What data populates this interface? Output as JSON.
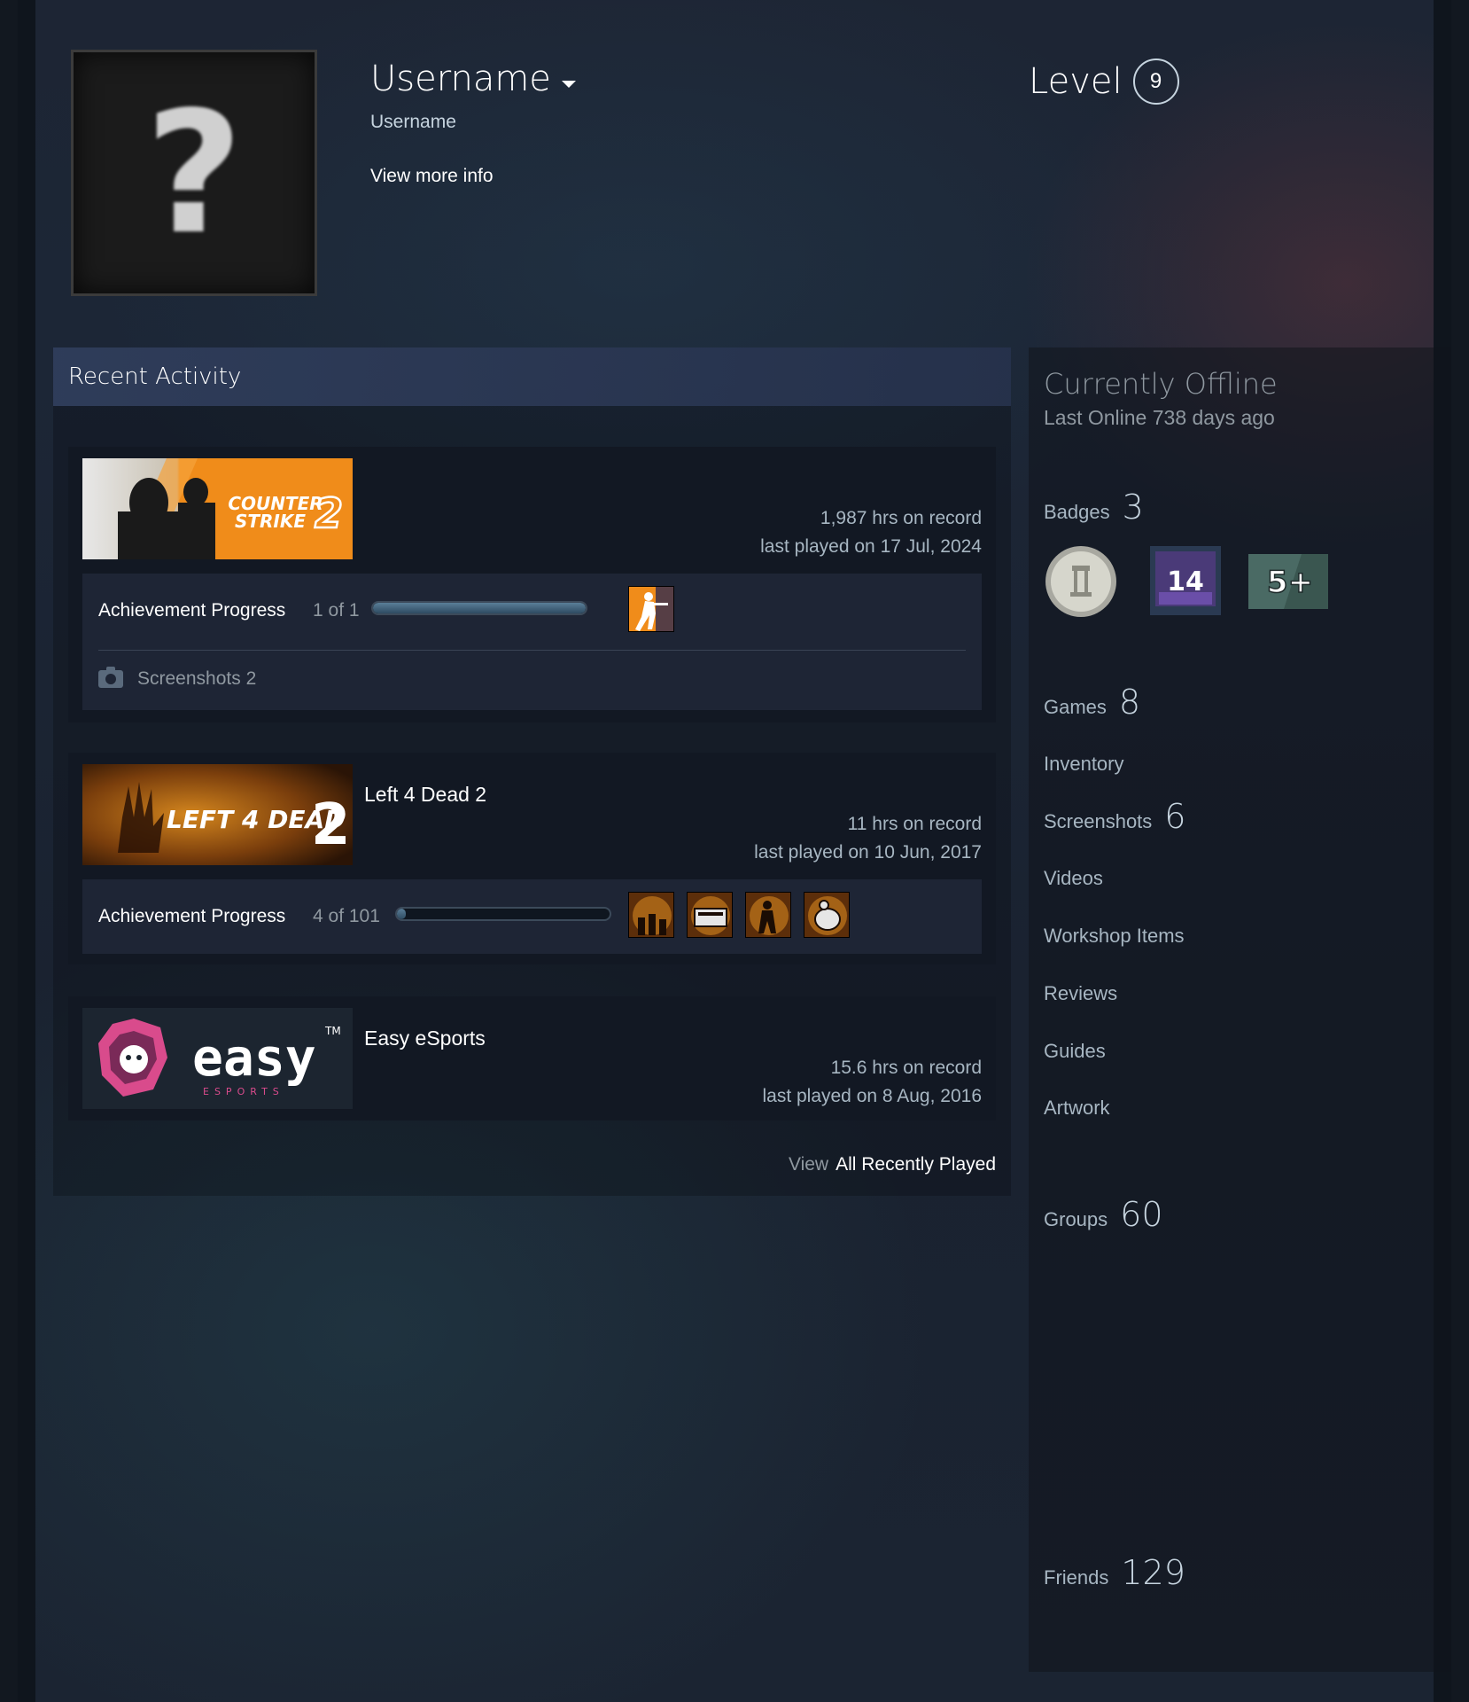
{
  "profile": {
    "persona_name": "Username",
    "real_name": "Username",
    "view_more": "View more info",
    "level_label": "Level",
    "level": "9"
  },
  "recent_activity": {
    "title": "Recent Activity",
    "games": [
      {
        "name": "",
        "logo_text": [
          "COUNTER",
          "STRIKE"
        ],
        "logo_number": "2",
        "hours": "1,987 hrs on record",
        "last_played": "last played on 17 Jul, 2024",
        "achievement_label": "Achievement Progress",
        "achievement_count": "1 of 1",
        "achievement_progress": 1.0,
        "screenshots_label": "Screenshots 2"
      },
      {
        "name": "Left 4 Dead 2",
        "logo_text": "LEFT 4 DEAD",
        "logo_number": "2",
        "hours": "11 hrs on record",
        "last_played": "last played on 10 Jun, 2017",
        "achievement_label": "Achievement Progress",
        "achievement_count": "4 of 101",
        "achievement_progress": 0.04
      },
      {
        "name": "Easy eSports",
        "logo_text": "easy",
        "logo_sub": "ESPORTS",
        "logo_tm": "TM",
        "hours": "15.6 hrs on record",
        "last_played": "last played on 8 Aug, 2016"
      }
    ],
    "view_label": "View",
    "view_all_label": "All Recently Played"
  },
  "sidebar": {
    "status": "Currently Offline",
    "last_online": "Last Online 738 days ago",
    "badges_label": "Badges",
    "badges_count": "3",
    "badge_2_text": "14",
    "badge_3_text": "5+",
    "games_label": "Games",
    "games_count": "8",
    "inventory": "Inventory",
    "screenshots_label": "Screenshots",
    "screenshots_count": "6",
    "videos": "Videos",
    "workshop": "Workshop Items",
    "reviews": "Reviews",
    "guides": "Guides",
    "artwork": "Artwork",
    "groups_label": "Groups",
    "groups_count": "60",
    "friends_label": "Friends",
    "friends_count": "129"
  },
  "colors": {
    "accent": "#ffffff",
    "muted": "#8f98a0",
    "panel": "#121823",
    "cs2_orange": "#f08c1a"
  }
}
